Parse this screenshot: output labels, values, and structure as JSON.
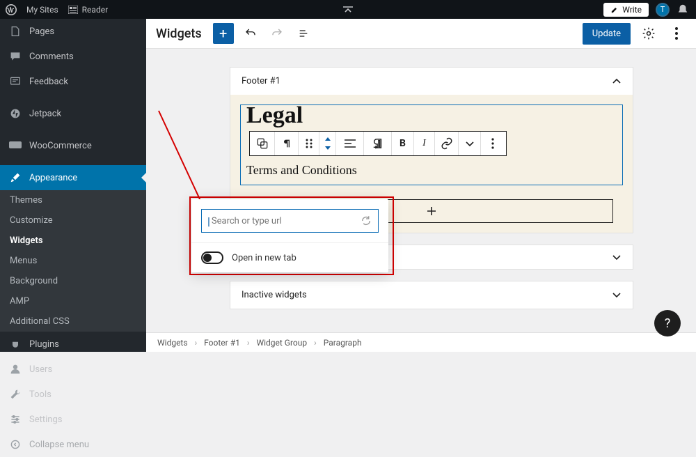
{
  "topbar": {
    "mysites": "My Sites",
    "reader": "Reader",
    "write": "Write",
    "avatar_letter": "T"
  },
  "sidebar": {
    "top_items": [
      {
        "label": "Pages",
        "id": "pages"
      },
      {
        "label": "Comments",
        "id": "comments"
      },
      {
        "label": "Feedback",
        "id": "feedback"
      },
      {
        "label": "Jetpack",
        "id": "jetpack"
      },
      {
        "label": "WooCommerce",
        "id": "woocommerce"
      }
    ],
    "appearance_label": "Appearance",
    "appearance_children": [
      {
        "label": "Themes",
        "current": false
      },
      {
        "label": "Customize",
        "current": false
      },
      {
        "label": "Widgets",
        "current": true
      },
      {
        "label": "Menus",
        "current": false
      },
      {
        "label": "Background",
        "current": false
      },
      {
        "label": "AMP",
        "current": false
      },
      {
        "label": "Additional CSS",
        "current": false
      }
    ],
    "bottom_items": [
      {
        "label": "Plugins",
        "id": "plugins"
      },
      {
        "label": "Users",
        "id": "users"
      },
      {
        "label": "Tools",
        "id": "tools"
      },
      {
        "label": "Settings",
        "id": "settings"
      }
    ],
    "collapse": "Collapse menu"
  },
  "editor": {
    "title": "Widgets",
    "update": "Update",
    "footer_panel_title": "Footer #1",
    "legal_heading": "Legal",
    "paragraph_text": "Terms and Conditions",
    "hidden_panel_title": "",
    "inactive_panel_title": "Inactive widgets"
  },
  "link_popover": {
    "placeholder": "Search or type url",
    "open_new_tab": "Open in new tab"
  },
  "breadcrumbs": [
    "Widgets",
    "Footer #1",
    "Widget Group",
    "Paragraph"
  ]
}
